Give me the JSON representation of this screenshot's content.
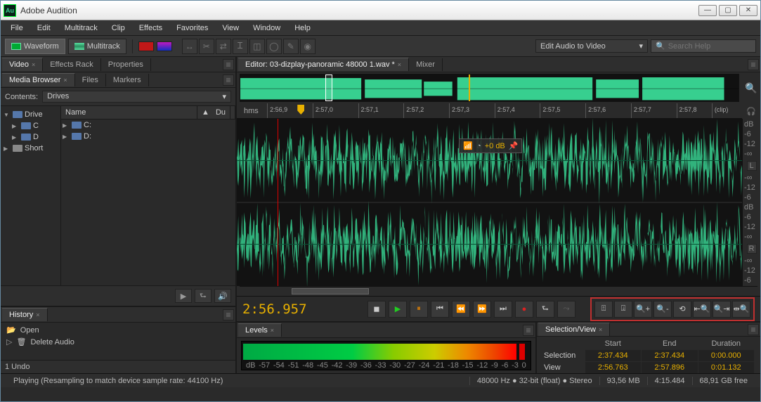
{
  "app": {
    "title": "Adobe Audition",
    "logo": "Au"
  },
  "menu": [
    "File",
    "Edit",
    "Multitrack",
    "Clip",
    "Effects",
    "Favorites",
    "View",
    "Window",
    "Help"
  ],
  "top_toolbar": {
    "waveform_label": "Waveform",
    "multitrack_label": "Multitrack",
    "workspace_dropdown": "Edit Audio to Video",
    "search_placeholder": "Search Help"
  },
  "left_panels": {
    "video_tab": "Video",
    "effects_rack_tab": "Effects Rack",
    "properties_tab": "Properties",
    "media_browser_tab": "Media Browser",
    "files_tab": "Files",
    "markers_tab": "Markers",
    "contents_label": "Contents:",
    "contents_value": "Drives",
    "tree_root": "Drive",
    "tree_c": "C",
    "tree_d": "D",
    "tree_short": "Short",
    "list_cols": {
      "name": "Name",
      "duration": "Du"
    },
    "list_items": [
      "C:",
      "D:"
    ],
    "history_tab": "History",
    "history_items": [
      "Open",
      "Delete Audio"
    ],
    "undo_count": "1 Undo"
  },
  "editor": {
    "editor_tab_prefix": "Editor: ",
    "file_name": "03-dizplay-panoramic 48000 1.wav *",
    "mixer_tab": "Mixer",
    "ruler_label": "hms",
    "ruler_ticks": [
      "2:56,9",
      "2:57,0",
      "2:57,1",
      "2:57,2",
      "2:57,3",
      "2:57,4",
      "2:57,5",
      "2:57,6",
      "2:57,7",
      "2:57,8",
      "(clip)"
    ],
    "db_scale": [
      "dB",
      "-6",
      "-12",
      "-∞",
      "-∞",
      "-12",
      "-6",
      "dB",
      "-6",
      "-12",
      "-∞",
      "-∞",
      "-12",
      "-6"
    ],
    "channels": {
      "left": "L",
      "right": "R"
    },
    "hud_value": "+0 dB",
    "timecode": "2:56.957"
  },
  "levels": {
    "tab": "Levels",
    "scale": [
      "dB",
      "-57",
      "-54",
      "-51",
      "-48",
      "-45",
      "-42",
      "-39",
      "-36",
      "-33",
      "-30",
      "-27",
      "-24",
      "-21",
      "-18",
      "-15",
      "-12",
      "-9",
      "-6",
      "-3",
      "0"
    ]
  },
  "selection_view": {
    "tab": "Selection/View",
    "cols": {
      "start": "Start",
      "end": "End",
      "duration": "Duration"
    },
    "rows": {
      "selection": {
        "label": "Selection",
        "start": "2:37.434",
        "end": "2:37.434",
        "duration": "0:00.000"
      },
      "view": {
        "label": "View",
        "start": "2:56.763",
        "end": "2:57.896",
        "duration": "0:01.132"
      }
    }
  },
  "status": {
    "playing": "Playing (Resampling to match device sample rate: 44100 Hz)",
    "sr": "48000 Hz",
    "bit": "32-bit (float)",
    "ch": "Stereo",
    "size": "93,56 MB",
    "dur": "4:15.484",
    "free": "68,91 GB free"
  }
}
